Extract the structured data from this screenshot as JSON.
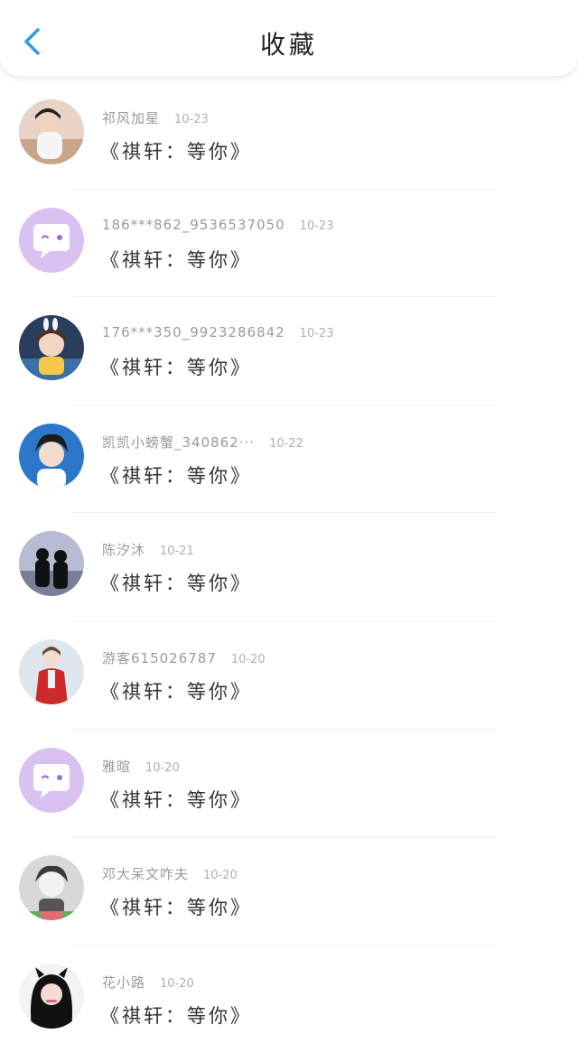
{
  "header": {
    "title": "收藏",
    "back_icon": "chevron-left-icon",
    "accent": "#2f9be0"
  },
  "items": [
    {
      "name": "祁风加星",
      "time": "10-23",
      "song": "《祺轩：等你》",
      "avatar": "photo"
    },
    {
      "name": "186***862_9536537050",
      "time": "10-23",
      "song": "《祺轩：等你》",
      "avatar": "default-chat"
    },
    {
      "name": "176***350_9923286842",
      "time": "10-23",
      "song": "《祺轩：等你》",
      "avatar": "photo"
    },
    {
      "name": "凯凯小螃蟹_340862···",
      "time": "10-22",
      "song": "《祺轩：等你》",
      "avatar": "photo"
    },
    {
      "name": "陈汐沐",
      "time": "10-21",
      "song": "《祺轩：等你》",
      "avatar": "photo"
    },
    {
      "name": "游客615026787",
      "time": "10-20",
      "song": "《祺轩：等你》",
      "avatar": "photo"
    },
    {
      "name": "雅暄",
      "time": "10-20",
      "song": "《祺轩：等你》",
      "avatar": "default-chat"
    },
    {
      "name": "邓大呆文咋夫",
      "time": "10-20",
      "song": "《祺轩：等你》",
      "avatar": "photo"
    },
    {
      "name": "花小路",
      "time": "10-20",
      "song": "《祺轩：等你》",
      "avatar": "photo"
    }
  ],
  "colors": {
    "default_avatar": "#d9c2f2",
    "text_primary": "#333333",
    "text_secondary": "#9b9b9b"
  }
}
